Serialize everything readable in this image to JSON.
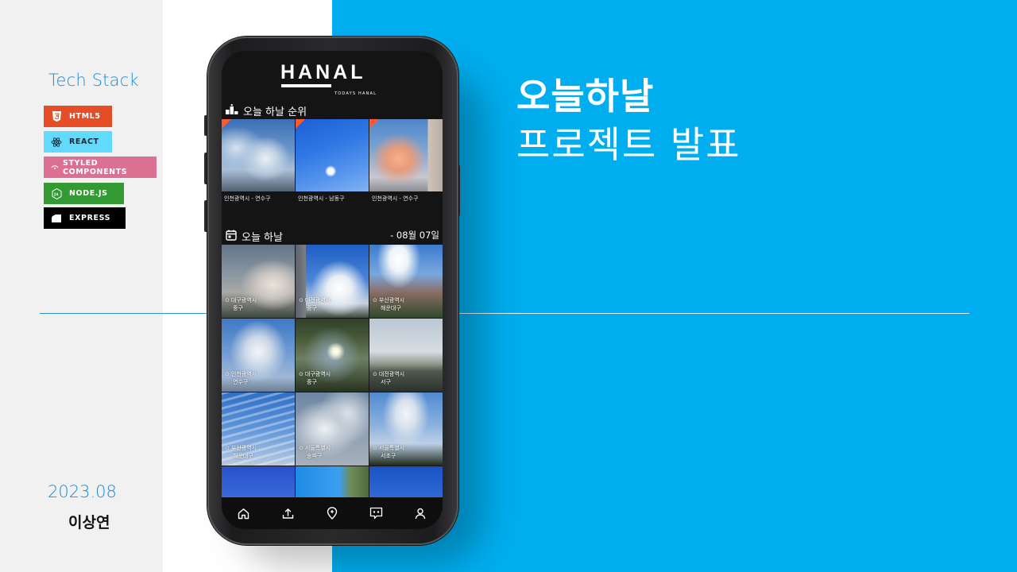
{
  "sidebar": {
    "tech_title": "Tech Stack",
    "badges": [
      {
        "label": "HTML5",
        "color": "#e44d26"
      },
      {
        "label": "REACT",
        "color": "#61dafb"
      },
      {
        "label": "STYLED COMPONENTS",
        "color": "#db7093"
      },
      {
        "label": "NODE.JS",
        "color": "#339933"
      },
      {
        "label": "EXPRESS",
        "color": "#000000"
      }
    ],
    "date": "2023.08",
    "author": "이상연"
  },
  "hero": {
    "title": "오늘하날",
    "subtitle": "프로젝트 발표"
  },
  "app": {
    "logo": "HANAL",
    "logo_sub": "TODAYS HANAL",
    "ranking_title": "오늘 하날 순위",
    "ranking": [
      {
        "caption": "인천광역시 - 연수구"
      },
      {
        "caption": "인천광역시 - 남동구"
      },
      {
        "caption": "인천광역시 - 연수구"
      }
    ],
    "today_title": "오늘 하날",
    "today_date": "- 08월 07일",
    "tiles": [
      {
        "city": "대구광역시",
        "district": "중구"
      },
      {
        "city": "대전광역시",
        "district": "중구"
      },
      {
        "city": "부산광역시",
        "district": "해운대구"
      },
      {
        "city": "인천광역시",
        "district": "연수구"
      },
      {
        "city": "대구광역시",
        "district": "중구"
      },
      {
        "city": "대전광역시",
        "district": "서구"
      },
      {
        "city": "부산광역시",
        "district": "해운대구"
      },
      {
        "city": "서울특별시",
        "district": "송파구"
      },
      {
        "city": "서울특별시",
        "district": "서초구"
      }
    ],
    "nav_icons": [
      "home-icon",
      "upload-icon",
      "location-pin-icon",
      "chat-icon",
      "profile-icon"
    ]
  }
}
